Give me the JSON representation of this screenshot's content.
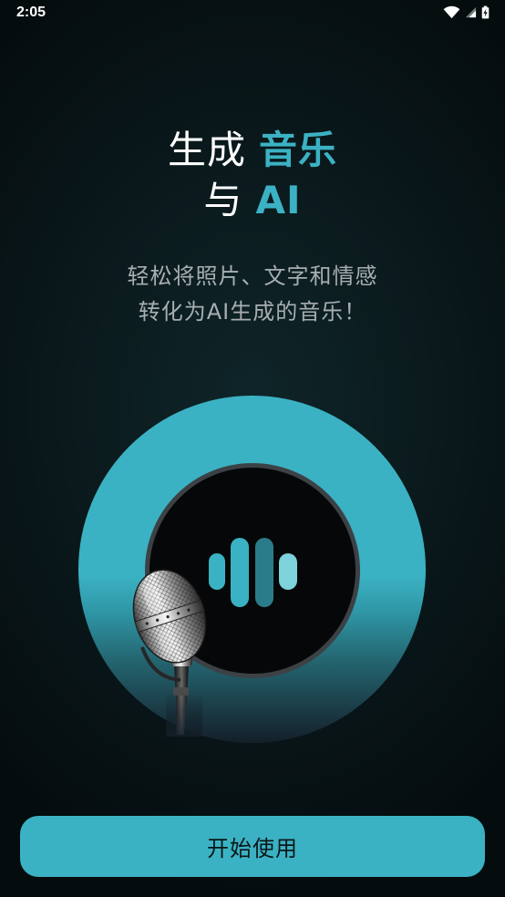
{
  "status_bar": {
    "time": "2:05",
    "icons": [
      "wifi-icon",
      "cellular-signal-icon",
      "battery-charging-icon"
    ]
  },
  "title": {
    "line1": {
      "plain": "生成",
      "accent": "音乐"
    },
    "line2": {
      "plain": "与",
      "accent": "AI"
    }
  },
  "subtitle": {
    "line1": "轻松将照片、文字和情感",
    "line2": "转化为AI生成的音乐！"
  },
  "illustration": {
    "icons": [
      "sound-wave-icon",
      "microphone-icon"
    ]
  },
  "start_button": {
    "label": "开始使用"
  },
  "colors": {
    "accent": "#3bb2c3",
    "text_primary": "#ffffff",
    "text_secondary": "#a7aeb1",
    "button_text": "#0b1618",
    "wave_dark": "#2b7c8b",
    "wave_light": "#7dd2dc"
  }
}
